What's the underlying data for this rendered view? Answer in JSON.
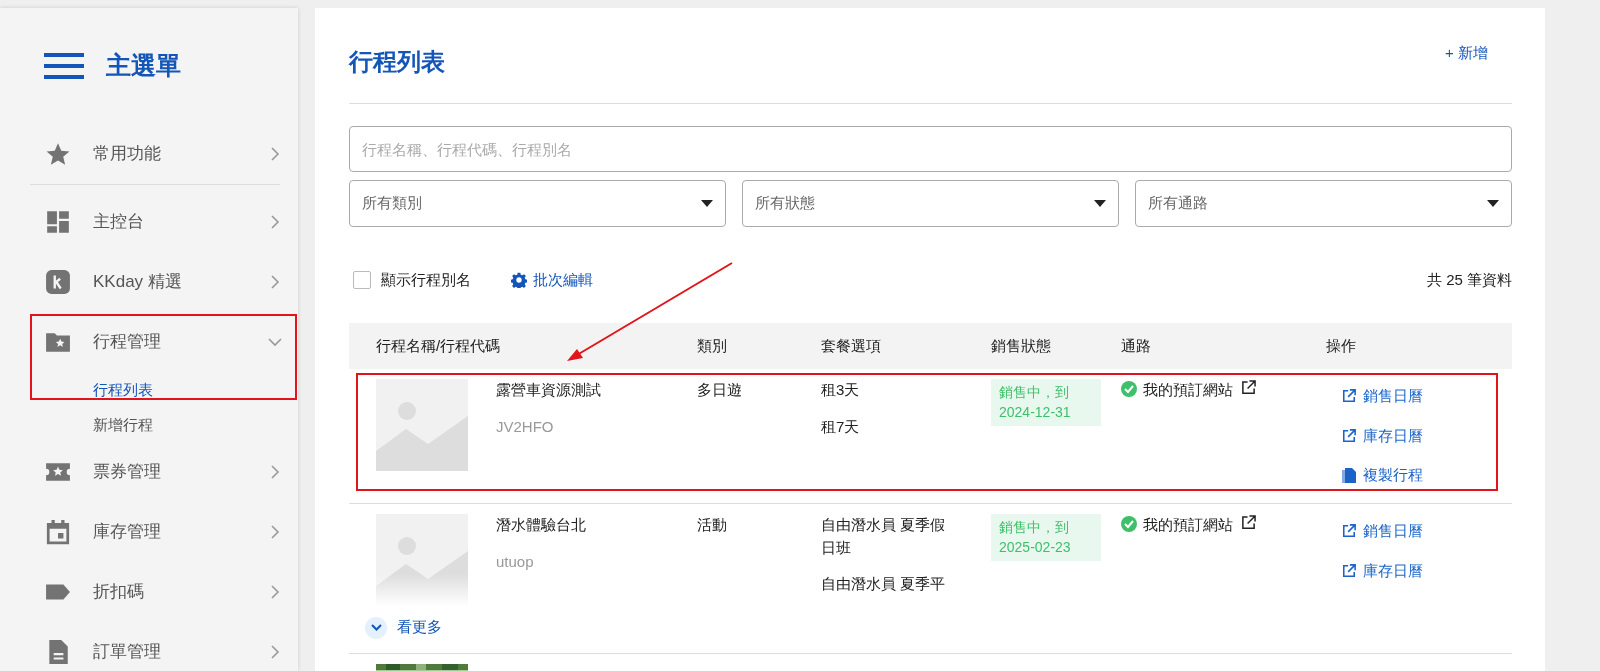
{
  "sidebar": {
    "title": "主選單",
    "sections": [
      [
        {
          "label": "常用功能",
          "expanded": false
        }
      ],
      [
        {
          "label": "主控台",
          "expanded": false
        },
        {
          "label": "KKday 精選",
          "expanded": false
        },
        {
          "label": "行程管理",
          "expanded": true,
          "children": [
            {
              "label": "行程列表",
              "selected": true
            },
            {
              "label": "新增行程",
              "selected": false
            }
          ]
        },
        {
          "label": "票券管理",
          "expanded": false
        },
        {
          "label": "庫存管理",
          "expanded": false
        },
        {
          "label": "折扣碼",
          "expanded": false
        },
        {
          "label": "訂單管理",
          "expanded": false
        }
      ]
    ]
  },
  "main": {
    "title": "行程列表",
    "add_button": "+ 新增",
    "search": {
      "placeholder": "行程名稱、行程代碼、行程別名"
    },
    "filters": [
      {
        "value": "所有類別"
      },
      {
        "value": "所有狀態"
      },
      {
        "value": "所有通路"
      }
    ],
    "show_alias": {
      "label": "顯示行程別名",
      "checked": false
    },
    "batch_edit": "批次編輯",
    "total": "共 25 筆資料",
    "table": {
      "columns": [
        "行程名稱/行程代碼",
        "類別",
        "套餐選項",
        "銷售狀態",
        "通路",
        "操作"
      ],
      "rows": [
        {
          "name": "露營車資源測試",
          "code": "JV2HFO",
          "category": "多日遊",
          "options": [
            "租3天",
            "租7天"
          ],
          "status": "銷售中，到 2024-12-31",
          "channel": "我的預訂網站",
          "actions": [
            {
              "label": "銷售日曆",
              "kind": "link"
            },
            {
              "label": "庫存日曆",
              "kind": "link"
            },
            {
              "label": "複製行程",
              "kind": "copy"
            }
          ],
          "collapsed": false
        },
        {
          "name": "潛水體驗台北",
          "code": "utuop",
          "category": "活動",
          "options": [
            "自由潛水員 夏季假日班",
            "自由潛水員 夏季平"
          ],
          "status": "銷售中，到 2025-02-23",
          "channel": "我的預訂網站",
          "actions": [
            {
              "label": "銷售日曆",
              "kind": "link"
            },
            {
              "label": "庫存日曆",
              "kind": "link"
            }
          ],
          "collapsed": true,
          "more_label": "看更多"
        },
        {
          "cut_off": true
        }
      ]
    }
  }
}
